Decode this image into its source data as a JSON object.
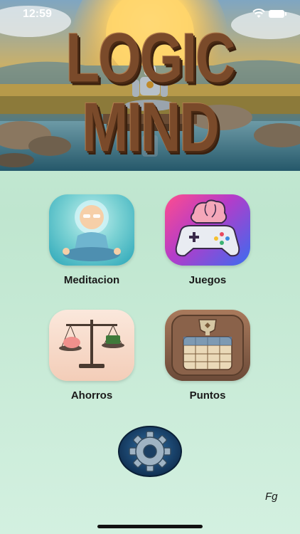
{
  "status_bar": {
    "time": "12:59"
  },
  "hero": {
    "title": "LOGIC MIND"
  },
  "tiles": [
    {
      "label": "Meditacion",
      "icon": "meditation-icon"
    },
    {
      "label": "Juegos",
      "icon": "brain-gamepad-icon"
    },
    {
      "label": "Ahorros",
      "icon": "balance-scale-icon"
    },
    {
      "label": "Puntos",
      "icon": "trophy-scoreboard-icon"
    }
  ],
  "settings": {
    "icon": "gear-icon"
  },
  "footer": {
    "signature": "Fg"
  },
  "colors": {
    "background": "#c9ecd8",
    "title": "#7a4a2a"
  }
}
